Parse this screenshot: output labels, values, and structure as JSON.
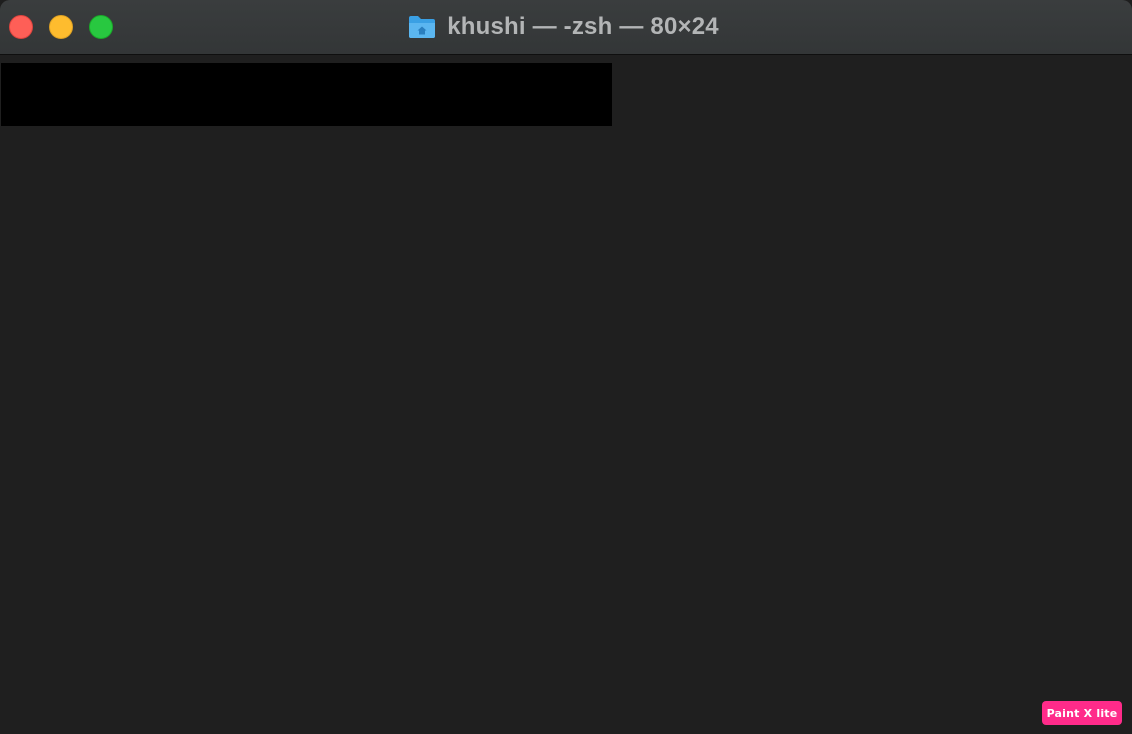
{
  "window": {
    "title": "khushi — -zsh — 80×24",
    "title_icon": "home-folder-icon",
    "buttons": {
      "close": "close",
      "minimize": "minimize",
      "zoom": "zoom"
    }
  },
  "colors": {
    "titlebar": "#353839",
    "background": "#1f1f1f",
    "close": "#fe5f57",
    "minimize": "#febc2e",
    "zoom": "#28c840",
    "folder": "#3aa0e4",
    "redaction": "#000000",
    "watermark": "#ff2b8a"
  },
  "terminal": {
    "redacted_output": ""
  },
  "watermark": {
    "text": "Paint X lite"
  }
}
